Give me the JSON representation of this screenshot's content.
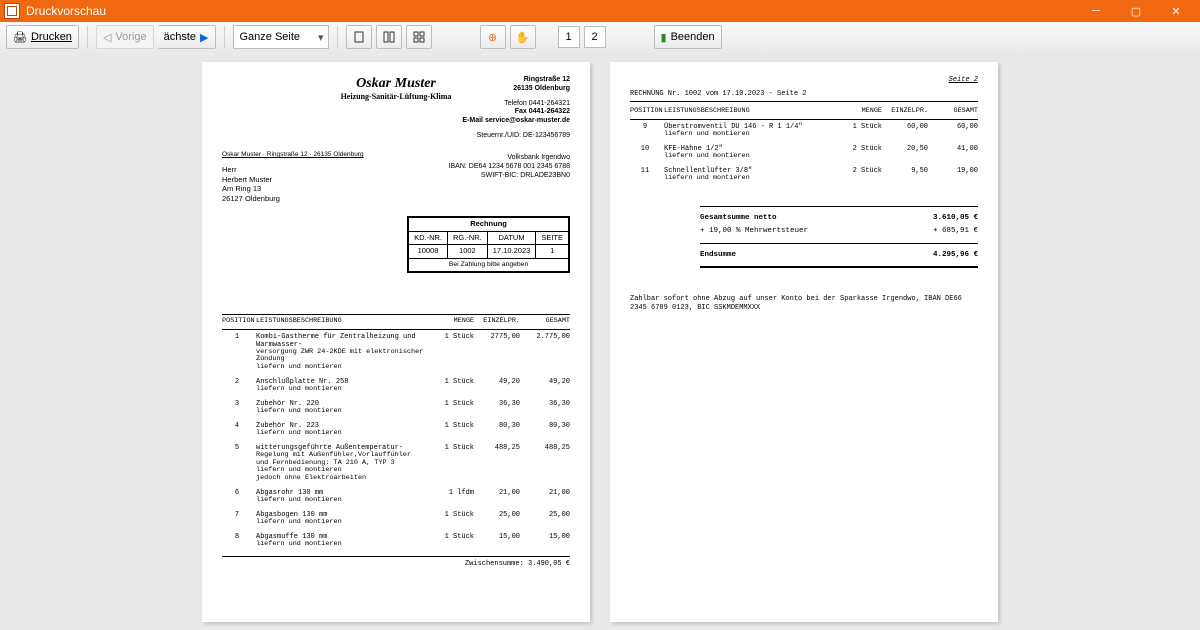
{
  "window": {
    "title": "Druckvorschau"
  },
  "toolbar": {
    "print": "Drucken",
    "prev": "Vorige",
    "next": "ächste",
    "zoom_mode": "Ganze Seite",
    "page_current": "1",
    "page_total": "2",
    "close": "Beenden"
  },
  "company": {
    "name": "Oskar Muster",
    "subtitle": "Heizung-Sanitär-Lüftung-Klima",
    "addr1": "Ringstraße 12",
    "addr2": "26135 Oldenburg",
    "tel": "Telefon 0441-264321",
    "fax": "Fax 0441-264322",
    "email_label": "E-Mail ",
    "email": "service@oskar-muster.de",
    "taxid": "Steuernr./UID: DE-123456789",
    "bank": "Volksbank Irgendwo",
    "iban": "IBAN: DE64 1234 5678 001 2345 6788",
    "bic": "SWIFT-BIC: DRLADE23BN0"
  },
  "sender_line": "Oskar Muster · Ringstraße 12 · 26135 Oldenburg",
  "recipient": {
    "l1": "Herr",
    "l2": "Herbert Muster",
    "l3": "Am Ring 13",
    "l4": "26127 Oldenburg"
  },
  "invoice_box": {
    "title": "Rechnung",
    "h_kd": "KD.-NR.",
    "h_rg": "RG.-NR.",
    "h_date": "DATUM",
    "h_page": "SEITE",
    "kd": "10008",
    "rg": "1002",
    "date": "17.10.2023",
    "page": "1",
    "note": "Bei Zahlung bitte angeben"
  },
  "columns": {
    "pos": "POSITION",
    "desc": "LEISTUNGSBESCHREIBUNG",
    "qty": "MENGE",
    "price": "EINZELPR.",
    "total": "GESAMT"
  },
  "items_p1": [
    {
      "pos": "1",
      "desc": "Kombi-Gastherme für Zentralheizung und Warmwasser-",
      "desc2": "versorgung ZWR 24-2KDE mit elektronischer Zündung",
      "desc3": "liefern und montieren",
      "qty": "1 Stück",
      "price": "2775,00",
      "total": "2.775,00"
    },
    {
      "pos": "2",
      "desc": "Anschlußplatte Nr. 258",
      "desc2": "liefern und montieren",
      "qty": "1 Stück",
      "price": "49,20",
      "total": "49,20"
    },
    {
      "pos": "3",
      "desc": "Zubehör Nr. 220",
      "desc2": "liefern und montieren",
      "qty": "1 Stück",
      "price": "36,30",
      "total": "36,30"
    },
    {
      "pos": "4",
      "desc": "Zubehör Nr. 223",
      "desc2": "liefern und montieren",
      "qty": "1 Stück",
      "price": "80,30",
      "total": "80,30"
    },
    {
      "pos": "5",
      "desc": "witterungsgeführte Außentemperatur-",
      "desc2": "Regelung mit Außenfühler,Vorlauffühler und Fernbedienung: TA 210 A, TYP 3",
      "desc3": "liefern und montieren",
      "desc4": "jedoch ohne Elektroarbeiten",
      "qty": "1 Stück",
      "price": "488,25",
      "total": "488,25"
    },
    {
      "pos": "6",
      "desc": "Abgasrohr 130 mm",
      "desc2": "liefern und montieren",
      "qty": "1 lfdm",
      "price": "21,00",
      "total": "21,00"
    },
    {
      "pos": "7",
      "desc": "Abgasbogen 130 mm",
      "desc2": "liefern und montieren",
      "qty": "1 Stück",
      "price": "25,00",
      "total": "25,00"
    },
    {
      "pos": "8",
      "desc": "Abgasmuffe 130 mm",
      "desc2": "liefern und montieren",
      "qty": "1 Stück",
      "price": "15,00",
      "total": "15,00"
    }
  ],
  "subtotal": {
    "label": "Zwischensumme:",
    "value": "3.490,05 €"
  },
  "page2": {
    "header": "Seite 2",
    "info": "RECHNUNG Nr. 1002 vom 17.10.2023 - Seite 2",
    "items": [
      {
        "pos": "9",
        "desc": "Überstromventil DU 146 - R 1 1/4\"",
        "desc2": "liefern und montieren",
        "qty": "1 Stück",
        "price": "60,00",
        "total": "60,00"
      },
      {
        "pos": "10",
        "desc": "KFE-Hähne 1/2\"",
        "desc2": "liefern und montieren",
        "qty": "2 Stück",
        "price": "20,50",
        "total": "41,00"
      },
      {
        "pos": "11",
        "desc": "Schnellentlüfter 3/8\"",
        "desc2": "liefern und montieren",
        "qty": "2 Stück",
        "price": "9,50",
        "total": "19,00"
      }
    ],
    "netto_label": "Gesamtsumme netto",
    "netto": "3.610,05 €",
    "vat_label": "+ 19,00 % Mehrwertsteuer",
    "vat": "+ 685,91 €",
    "final_label": "Endsumme",
    "final": "4.295,96 €",
    "paynote": "Zahlbar sofort ohne Abzug auf unser Konto bei der Sparkasse Irgendwo, IBAN DE66 2345 6789 0123, BIC SSKMDEMMXXX"
  }
}
